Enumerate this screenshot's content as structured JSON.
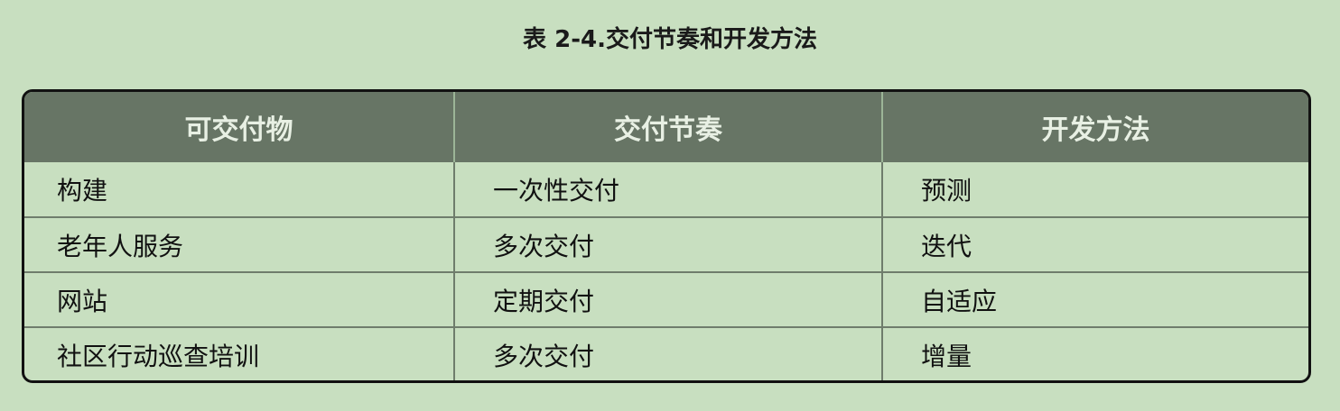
{
  "caption": "表 2-4.交付节奏和开发方法",
  "headers": [
    "可交付物",
    "交付节奏",
    "开发方法"
  ],
  "rows": [
    [
      "构建",
      "一次性交付",
      "预测"
    ],
    [
      "老年人服务",
      "多次交付",
      "迭代"
    ],
    [
      "网站",
      "定期交付",
      "自适应"
    ],
    [
      "社区行动巡查培训",
      "多次交付",
      "增量"
    ]
  ]
}
